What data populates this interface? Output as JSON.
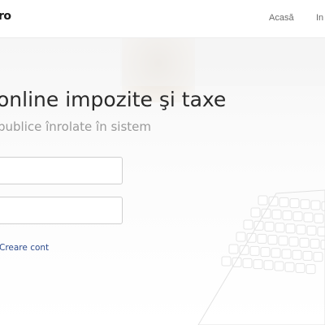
{
  "header": {
    "logo_text": "ro",
    "nav": {
      "home": "Acasă",
      "register": "In"
    }
  },
  "hero": {
    "title": "online impozite şi taxe",
    "subtitle": "publice înrolate în sistem"
  },
  "login_form": {
    "username_value": "",
    "password_value": "",
    "create_account_link": "Creare cont"
  },
  "colors": {
    "link": "#2c4a8c",
    "title": "#2a2a2a",
    "subtitle": "#9a9a9a"
  }
}
